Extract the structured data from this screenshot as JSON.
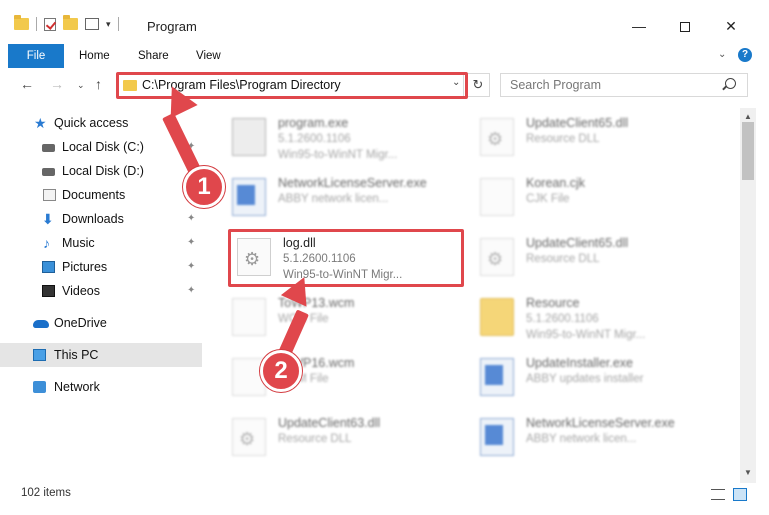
{
  "window": {
    "title": "Program",
    "minimize": "—",
    "close": "✕"
  },
  "ribbon": {
    "tabs": [
      "File",
      "Home",
      "Share",
      "View"
    ],
    "help": "?"
  },
  "navbar": {
    "address": "C:\\Program Files\\Program Directory",
    "search_placeholder": "Search Program"
  },
  "sidebar": {
    "items": [
      {
        "label": "Quick access",
        "icon": "star-icon",
        "pinned": false
      },
      {
        "label": "Local Disk (C:)",
        "icon": "disk-icon",
        "pinned": true
      },
      {
        "label": "Local Disk (D:)",
        "icon": "disk-icon",
        "pinned": true
      },
      {
        "label": "Documents",
        "icon": "documents-icon",
        "pinned": true
      },
      {
        "label": "Downloads",
        "icon": "download-icon",
        "pinned": true
      },
      {
        "label": "Music",
        "icon": "music-icon",
        "pinned": true
      },
      {
        "label": "Pictures",
        "icon": "pictures-icon",
        "pinned": true
      },
      {
        "label": "Videos",
        "icon": "videos-icon",
        "pinned": true
      },
      {
        "label": "OneDrive",
        "icon": "cloud-icon",
        "pinned": false
      },
      {
        "label": "This PC",
        "icon": "pc-icon",
        "pinned": false
      },
      {
        "label": "Network",
        "icon": "network-icon",
        "pinned": false
      }
    ]
  },
  "files": {
    "left": [
      {
        "name": "program.exe",
        "line1": "5.1.2600.1106",
        "line2": "Win95-to-WinNT Migr...",
        "icon": "program-icon"
      },
      {
        "name": "NetworkLicenseServer.exe",
        "line1": "ABBY network licen...",
        "line2": "",
        "icon": "app-icon"
      },
      {
        "name": "log.dll",
        "line1": "5.1.2600.1106",
        "line2": "Win95-to-WinNT Migr...",
        "icon": "dll-gear-icon"
      },
      {
        "name": "ToWP13.wcm",
        "line1": "WCM File",
        "line2": "",
        "icon": "file-icon"
      },
      {
        "name": "ToWP16.wcm",
        "line1": "WCM File",
        "line2": "",
        "icon": "file-icon"
      },
      {
        "name": "UpdateClient63.dll",
        "line1": "Resource DLL",
        "line2": "",
        "icon": "dll-gear-icon"
      }
    ],
    "right": [
      {
        "name": "UpdateClient65.dll",
        "line1": "Resource DLL",
        "line2": "",
        "icon": "dll-gear-icon"
      },
      {
        "name": "Korean.cjk",
        "line1": "CJK File",
        "line2": "",
        "icon": "file-icon"
      },
      {
        "name": "UpdateClient65.dll",
        "line1": "Resource DLL",
        "line2": "",
        "icon": "dll-gear-icon"
      },
      {
        "name": "Resource",
        "line1": "5.1.2600.1106",
        "line2": "Win95-to-WinNT Migr...",
        "icon": "folder-icon"
      },
      {
        "name": "UpdateInstaller.exe",
        "line1": "ABBY updates installer",
        "line2": "",
        "icon": "app-icon"
      },
      {
        "name": "NetworkLicenseServer.exe",
        "line1": "ABBY network licen...",
        "line2": "",
        "icon": "app-icon"
      }
    ]
  },
  "status": {
    "items_count": "102 items"
  },
  "callouts": [
    "1",
    "2"
  ],
  "colors": {
    "accent": "#1979ca",
    "highlight": "#e0474c",
    "selected_bg": "#cce4f7"
  }
}
